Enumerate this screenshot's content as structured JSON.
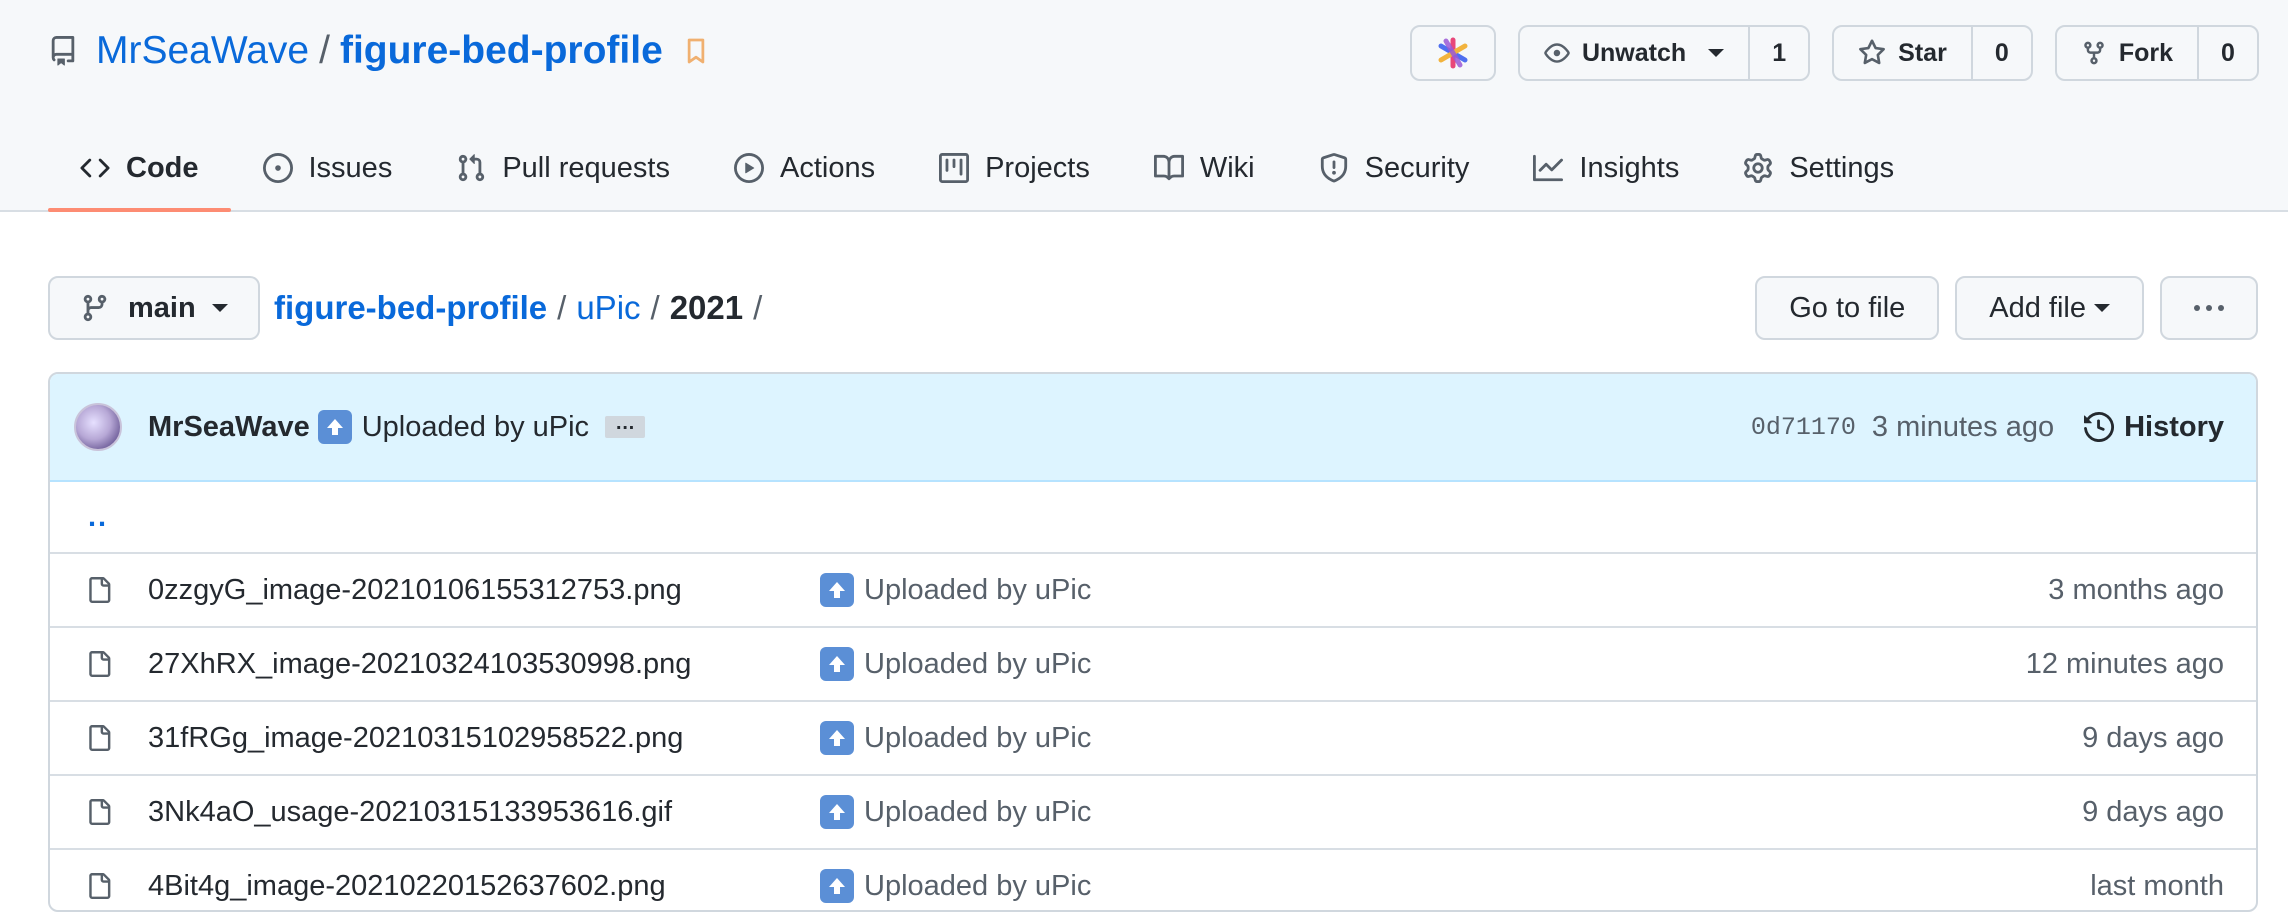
{
  "repo": {
    "owner": "MrSeaWave",
    "separator": "/",
    "name": "figure-bed-profile"
  },
  "header_actions": {
    "watch_label": "Unwatch",
    "watch_count": "1",
    "star_label": "Star",
    "star_count": "0",
    "fork_label": "Fork",
    "fork_count": "0"
  },
  "tabs": [
    {
      "label": "Code",
      "icon": "code-icon",
      "selected": true
    },
    {
      "label": "Issues",
      "icon": "issue-opened-icon"
    },
    {
      "label": "Pull requests",
      "icon": "git-pull-request-icon"
    },
    {
      "label": "Actions",
      "icon": "play-icon"
    },
    {
      "label": "Projects",
      "icon": "project-icon"
    },
    {
      "label": "Wiki",
      "icon": "book-icon"
    },
    {
      "label": "Security",
      "icon": "shield-icon"
    },
    {
      "label": "Insights",
      "icon": "graph-icon"
    },
    {
      "label": "Settings",
      "icon": "gear-icon"
    }
  ],
  "nav": {
    "branch": "main",
    "breadcrumb": {
      "root": "figure-bed-profile",
      "sep": "/",
      "folder": "uPic",
      "current": "2021"
    },
    "go_to_file": "Go to file",
    "add_file": "Add file",
    "more": "···"
  },
  "latest_commit": {
    "author": "MrSeaWave",
    "message": "Uploaded by uPic",
    "ellipsis": "…",
    "sha": "0d71170",
    "time": "3 minutes ago",
    "history_label": "History"
  },
  "parent_dir": "..",
  "files": [
    {
      "name": "0zzgyG_image-20210106155312753.png",
      "message": "Uploaded by uPic",
      "age": "3 months ago"
    },
    {
      "name": "27XhRX_image-20210324103530998.png",
      "message": "Uploaded by uPic",
      "age": "12 minutes ago"
    },
    {
      "name": "31fRGg_image-20210315102958522.png",
      "message": "Uploaded by uPic",
      "age": "9 days ago"
    },
    {
      "name": "3Nk4aO_usage-20210315133953616.gif",
      "message": "Uploaded by uPic",
      "age": "9 days ago"
    },
    {
      "name": "4Bit4g_image-20210220152637602.png",
      "message": "Uploaded by uPic",
      "age": "last month"
    }
  ],
  "colors": {
    "link": "#0969da",
    "tab_underline": "#fd8c73",
    "commit_bar_bg": "#ddf4ff",
    "bookmark": "#f0b070"
  }
}
